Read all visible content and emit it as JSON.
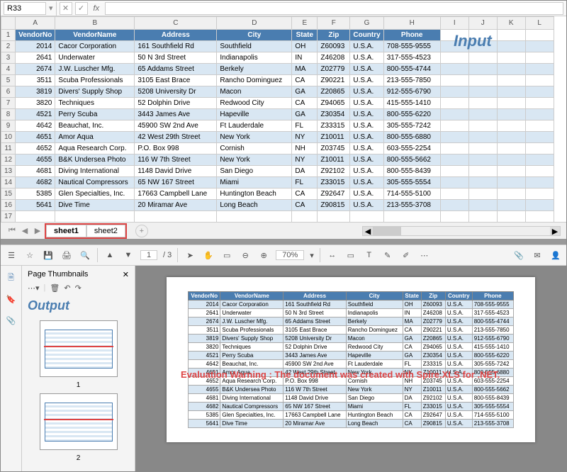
{
  "formula": {
    "cell_ref": "R33",
    "fx": "fx"
  },
  "columns": [
    "A",
    "B",
    "C",
    "D",
    "E",
    "F",
    "G",
    "H",
    "I",
    "J",
    "K",
    "L"
  ],
  "headers": [
    "VendorNo",
    "VendorName",
    "Address",
    "City",
    "State",
    "Zip",
    "Country",
    "Phone"
  ],
  "rows": [
    [
      "2014",
      "Cacor Corporation",
      "161 Southfield Rd",
      "Southfield",
      "OH",
      "Z60093",
      "U.S.A.",
      "708-555-9555"
    ],
    [
      "2641",
      "Underwater",
      "50 N 3rd Street",
      "Indianapolis",
      "IN",
      "Z46208",
      "U.S.A.",
      "317-555-4523"
    ],
    [
      "2674",
      "J.W.  Luscher Mfg.",
      "65 Addams Street",
      "Berkely",
      "MA",
      "Z02779",
      "U.S.A.",
      "800-555-4744"
    ],
    [
      "3511",
      "Scuba Professionals",
      "3105 East Brace",
      "Rancho Dominguez",
      "CA",
      "Z90221",
      "U.S.A.",
      "213-555-7850"
    ],
    [
      "3819",
      "Divers'  Supply Shop",
      "5208 University Dr",
      "Macon",
      "GA",
      "Z20865",
      "U.S.A.",
      "912-555-6790"
    ],
    [
      "3820",
      "Techniques",
      "52 Dolphin Drive",
      "Redwood City",
      "CA",
      "Z94065",
      "U.S.A.",
      "415-555-1410"
    ],
    [
      "4521",
      "Perry Scuba",
      "3443 James Ave",
      "Hapeville",
      "GA",
      "Z30354",
      "U.S.A.",
      "800-555-6220"
    ],
    [
      "4642",
      "Beauchat, Inc.",
      "45900 SW 2nd Ave",
      "Ft Lauderdale",
      "FL",
      "Z33315",
      "U.S.A.",
      "305-555-7242"
    ],
    [
      "4651",
      "Amor Aqua",
      "42 West 29th Street",
      "New York",
      "NY",
      "Z10011",
      "U.S.A.",
      "800-555-6880"
    ],
    [
      "4652",
      "Aqua Research Corp.",
      "P.O. Box 998",
      "Cornish",
      "NH",
      "Z03745",
      "U.S.A.",
      "603-555-2254"
    ],
    [
      "4655",
      "B&K Undersea Photo",
      "116 W 7th Street",
      "New York",
      "NY",
      "Z10011",
      "U.S.A.",
      "800-555-5662"
    ],
    [
      "4681",
      "Diving International",
      "1148 David Drive",
      "San Diego",
      "DA",
      "Z92102",
      "U.S.A.",
      "800-555-8439"
    ],
    [
      "4682",
      "Nautical Compressors",
      "65 NW 167 Street",
      "Miami",
      "FL",
      "Z33015",
      "U.S.A.",
      "305-555-5554"
    ],
    [
      "5385",
      "Glen Specialties, Inc.",
      "17663 Campbell Lane",
      "Huntington Beach",
      "CA",
      "Z92647",
      "U.S.A.",
      "714-555-5100"
    ],
    [
      "5641",
      "Dive Time",
      "20 Miramar Ave",
      "Long Beach",
      "CA",
      "Z90815",
      "U.S.A.",
      "213-555-3708"
    ]
  ],
  "labels": {
    "input": "Input",
    "output": "Output"
  },
  "tabs": {
    "sheet1": "sheet1",
    "sheet2": "sheet2"
  },
  "viewer": {
    "page_current": "1",
    "page_total": "/ 3",
    "zoom": "70%",
    "thumb_title": "Page Thumbnails",
    "thumb1": "1",
    "thumb2": "2",
    "watermark": "Evaluation Warning : The document was created with Spire.XLS for .NET."
  },
  "col_widths": [
    "54",
    "112",
    "116",
    "106",
    "36",
    "46",
    "46",
    "80",
    "40",
    "40",
    "40",
    "40"
  ]
}
